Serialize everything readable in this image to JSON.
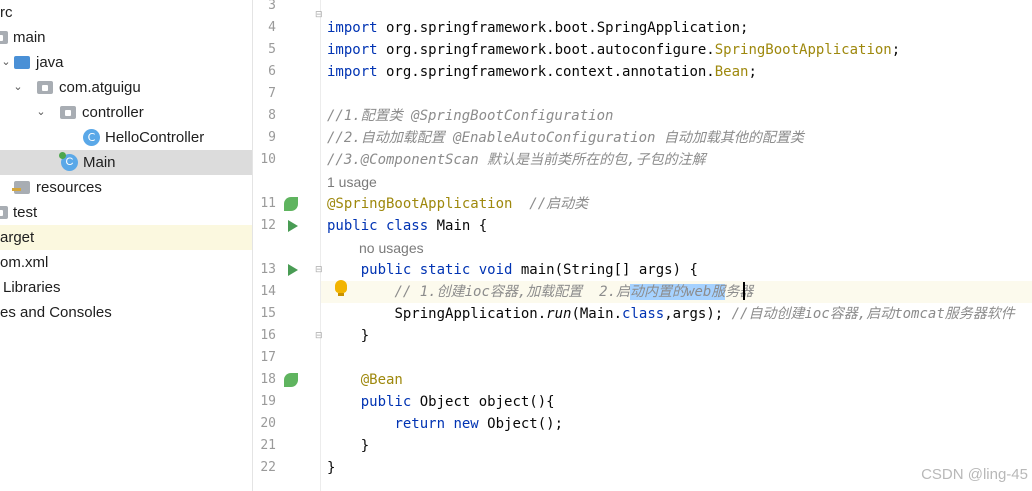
{
  "project_tree": {
    "items": [
      {
        "label": "rc"
      },
      {
        "label": "main"
      },
      {
        "label": "java"
      },
      {
        "label": "com.atguigu"
      },
      {
        "label": "controller"
      },
      {
        "label": "HelloController"
      },
      {
        "label": "Main"
      },
      {
        "label": "resources"
      },
      {
        "label": "test"
      },
      {
        "label": "arget"
      },
      {
        "label": "om.xml"
      },
      {
        "label": "Libraries"
      },
      {
        "label": "es and Consoles"
      }
    ]
  },
  "editor": {
    "line_numbers": [
      "3",
      "4",
      "5",
      "6",
      "7",
      "8",
      "9",
      "10",
      "11",
      "12",
      "13",
      "14",
      "15",
      "16",
      "17",
      "18",
      "19",
      "20",
      "21",
      "22"
    ],
    "hints": {
      "usage": "1 usage",
      "no_usages": "no usages"
    },
    "lines": {
      "l4": {
        "kw": "import",
        "rest": " org.springframework.boot.SpringApplication;"
      },
      "l5": {
        "kw": "import",
        "rest_a": " org.springframework.boot.autoconfigure.",
        "ann": "SpringBootApplication",
        "rest_b": ";"
      },
      "l6": {
        "kw": "import",
        "rest_a": " org.springframework.context.annotation.",
        "ann": "Bean",
        "rest_b": ";"
      },
      "l8": "//1.配置类 @SpringBootConfiguration",
      "l9": "//2.自动加载配置 @EnableAutoConfiguration 自动加载其他的配置类",
      "l10": "//3.@ComponentScan 默认是当前类所在的包,子包的注解",
      "l11": {
        "ann": "@SpringBootApplication",
        "cmt": "  //启动类"
      },
      "l12": {
        "kw": "public class",
        "rest": " Main {"
      },
      "l13": {
        "kw": "public static void",
        "rest": " main(String[] args) {"
      },
      "l14": {
        "pre": "// 1.创建ioc容器,加载配置  2.启",
        "sel": "动内置的web服",
        "post": "务器"
      },
      "l15": {
        "a": "SpringApplication.",
        "method": "run",
        "b": "(Main.",
        "kw": "class",
        "c": ",args); ",
        "cmt": "//自动创建ioc容器,启动tomcat服务器软件"
      },
      "l16": "}",
      "l18": "@Bean",
      "l19": {
        "kw": "public",
        "rest": " Object object(){"
      },
      "l20": {
        "kw": "return new",
        "rest": " Object();"
      },
      "l21": "}",
      "l22": "}"
    }
  },
  "watermark": "CSDN @ling-45",
  "colors": {
    "keyword": "#0033b3",
    "annotation": "#9e880d",
    "comment": "#8c8c8c",
    "selection": "#a6d2ff"
  }
}
